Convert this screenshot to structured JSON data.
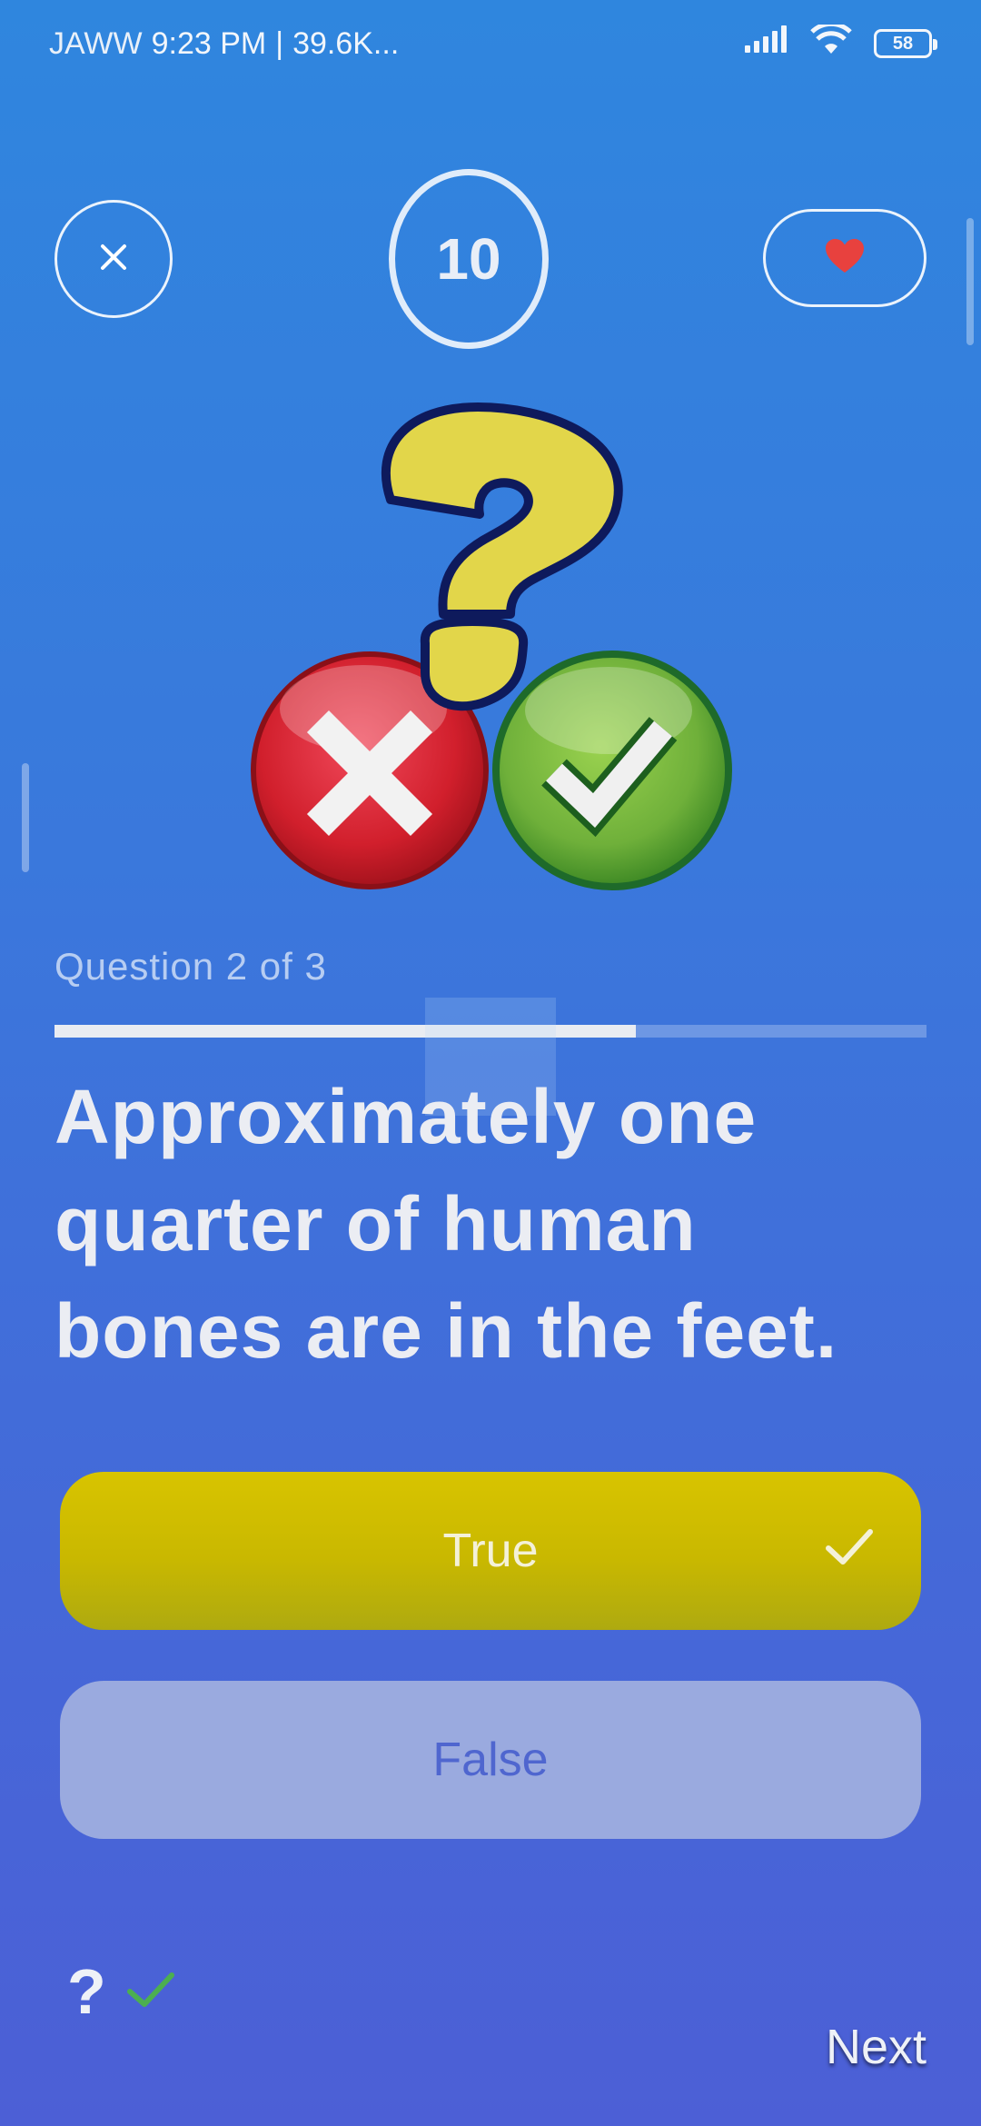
{
  "status_bar": {
    "carrier": "JAWW",
    "time": "9:23 PM",
    "separator": "|",
    "data_rate": "39.6K...",
    "battery": "58"
  },
  "header": {
    "timer_value": "10"
  },
  "quiz": {
    "counter": "Question 2 of 3",
    "progress_fraction": 0.667,
    "question": "Approximately one quarter of human bones are in the feet.",
    "answers": [
      {
        "label": "True",
        "selected": true
      },
      {
        "label": "False",
        "selected": false
      }
    ]
  },
  "footer": {
    "hint": "?",
    "next_label": "Next"
  },
  "colors": {
    "true_button": "#d1c000",
    "false_button": "#9aaadf",
    "heart": "#e8413e",
    "hint_check": "#4caf50"
  }
}
